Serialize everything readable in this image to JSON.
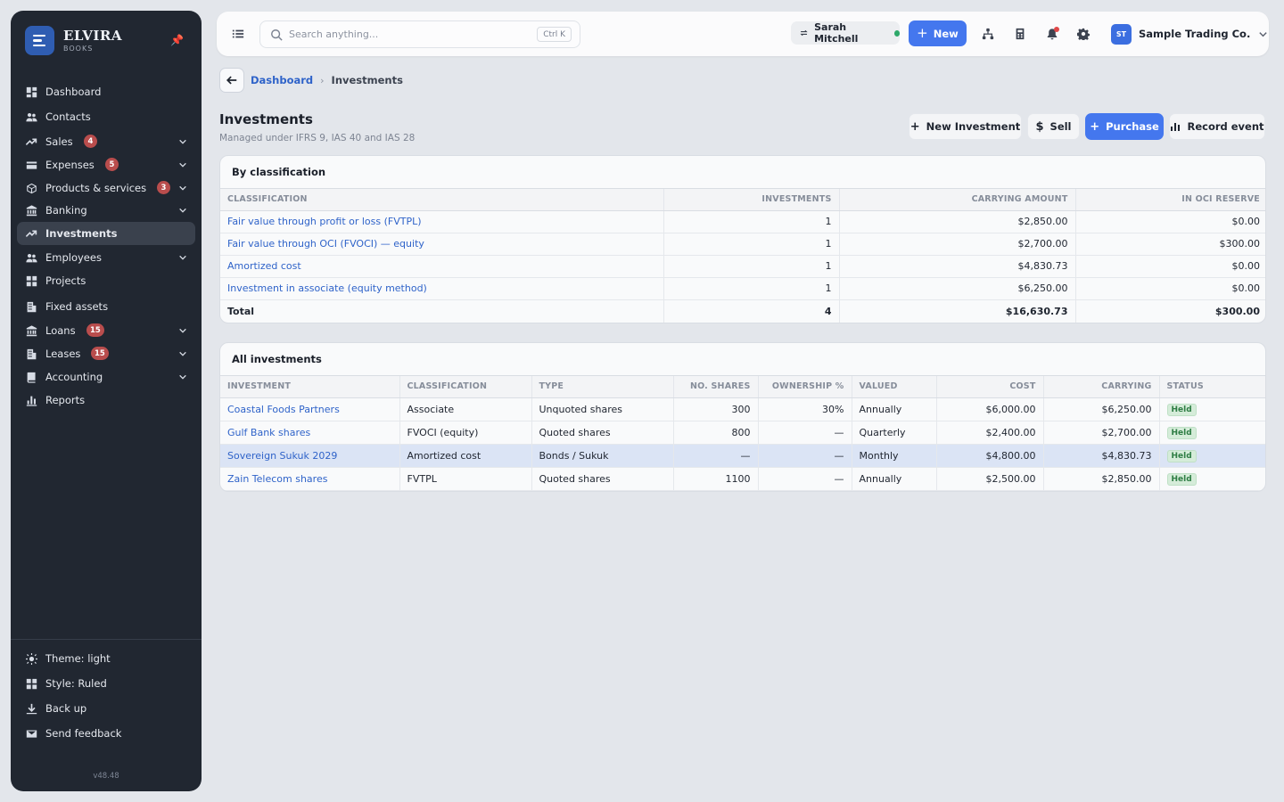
{
  "brand": {
    "name": "ELVIRA",
    "sub": "BOOKS"
  },
  "sidebar": {
    "items": [
      {
        "label": "Dashboard",
        "icon": "dashboard-icon"
      },
      {
        "label": "Contacts",
        "icon": "contacts-icon"
      },
      {
        "label": "Sales",
        "icon": "trend-icon",
        "badge": "4",
        "chevron": true
      },
      {
        "label": "Expenses",
        "icon": "card-icon",
        "badge": "5",
        "chevron": true
      },
      {
        "label": "Products & services",
        "icon": "box-icon",
        "badge": "3",
        "chevron": true
      },
      {
        "label": "Banking",
        "icon": "bank-icon",
        "chevron": true
      },
      {
        "label": "Investments",
        "icon": "trend-icon",
        "active": true
      },
      {
        "label": "Employees",
        "icon": "people-icon",
        "chevron": true
      },
      {
        "label": "Projects",
        "icon": "grid-icon"
      },
      {
        "label": "Fixed assets",
        "icon": "building-icon"
      },
      {
        "label": "Loans",
        "icon": "bank-icon",
        "badge": "15",
        "chevron": true
      },
      {
        "label": "Leases",
        "icon": "building-icon",
        "badge": "15",
        "chevron": true
      },
      {
        "label": "Accounting",
        "icon": "book-icon",
        "chevron": true
      },
      {
        "label": "Reports",
        "icon": "bar-chart-icon"
      }
    ],
    "bottom": [
      {
        "label": "Theme: light",
        "icon": "sun-icon"
      },
      {
        "label": "Style: Ruled",
        "icon": "grid-icon"
      },
      {
        "label": "Back up",
        "icon": "download-icon"
      },
      {
        "label": "Send feedback",
        "icon": "mail-icon"
      }
    ],
    "version": "v48.48"
  },
  "topbar": {
    "search_placeholder": "Search anything...",
    "search_shortcut": "Ctrl K",
    "user": "Sarah Mitchell",
    "new_label": "New",
    "company_initials": "ST",
    "company_name": "Sample Trading Co."
  },
  "breadcrumb": {
    "parent": "Dashboard",
    "current": "Investments"
  },
  "page": {
    "title": "Investments",
    "subtitle": "Managed under IFRS 9, IAS 40 and IAS 28",
    "actions": {
      "new_investment": "New Investment",
      "sell": "Sell",
      "purchase": "Purchase",
      "record_event": "Record event"
    }
  },
  "by_classification": {
    "title": "By classification",
    "headers": [
      "Classification",
      "Investments",
      "Carrying amount",
      "In OCI reserve"
    ],
    "rows": [
      [
        "Fair value through profit or loss (FVTPL)",
        "1",
        "$2,850.00",
        "$0.00"
      ],
      [
        "Fair value through OCI (FVOCI) — equity",
        "1",
        "$2,700.00",
        "$300.00"
      ],
      [
        "Amortized cost",
        "1",
        "$4,830.73",
        "$0.00"
      ],
      [
        "Investment in associate (equity method)",
        "1",
        "$6,250.00",
        "$0.00"
      ]
    ],
    "total": [
      "Total",
      "4",
      "$16,630.73",
      "$300.00"
    ]
  },
  "all_investments": {
    "title": "All investments",
    "headers": [
      "Investment",
      "Classification",
      "Type",
      "No. shares",
      "Ownership %",
      "Valued",
      "Cost",
      "Carrying",
      "Status"
    ],
    "rows": [
      [
        "Coastal Foods Partners",
        "Associate",
        "Unquoted shares",
        "300",
        "30%",
        "Annually",
        "$6,000.00",
        "$6,250.00",
        "Held"
      ],
      [
        "Gulf Bank shares",
        "FVOCI (equity)",
        "Quoted shares",
        "800",
        "—",
        "Quarterly",
        "$2,400.00",
        "$2,700.00",
        "Held"
      ],
      [
        "Sovereign Sukuk 2029",
        "Amortized cost",
        "Bonds / Sukuk",
        "—",
        "—",
        "Monthly",
        "$4,800.00",
        "$4,830.73",
        "Held"
      ],
      [
        "Zain Telecom shares",
        "FVTPL",
        "Quoted shares",
        "1100",
        "—",
        "Annually",
        "$2,500.00",
        "$2,850.00",
        "Held"
      ]
    ]
  },
  "colors": {
    "accent": "#4477ee",
    "sidebar_bg": "#212731",
    "badge": "#b94d4d",
    "held": "#2e7d44"
  }
}
